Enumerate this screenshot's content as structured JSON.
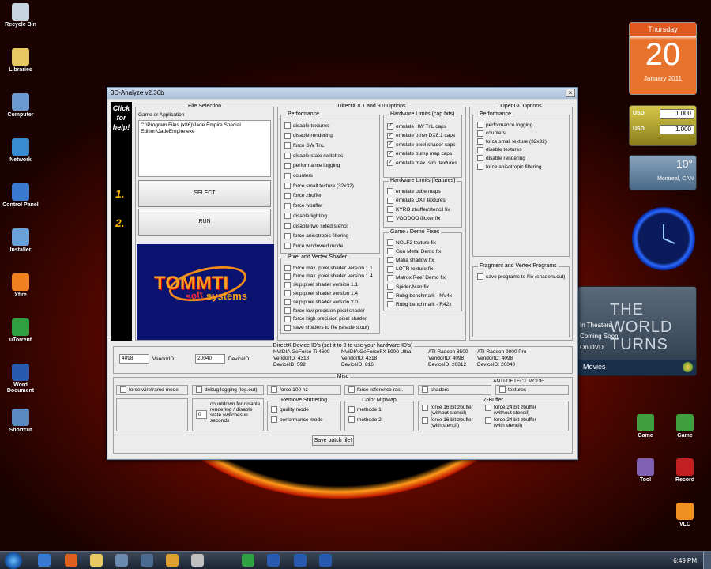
{
  "desktop_icons": [
    {
      "label": "Recycle Bin",
      "color": "#c8d4e0"
    },
    {
      "label": "Libraries",
      "color": "#e8c860"
    },
    {
      "label": "Computer",
      "color": "#6a9ad0"
    },
    {
      "label": "Network",
      "color": "#3a8ad0"
    },
    {
      "label": "Control Panel",
      "color": "#3a7ad0"
    },
    {
      "label": "Installer",
      "color": "#6aa0d8"
    },
    {
      "label": "Xfire",
      "color": "#f08020"
    },
    {
      "label": "uTorrent",
      "color": "#30a040"
    },
    {
      "label": "Word Document",
      "color": "#2a5ab0"
    },
    {
      "label": "Shortcut",
      "color": "#5a8ac0"
    }
  ],
  "right_icons": [
    {
      "label": "Game",
      "color": "#40a040"
    },
    {
      "label": "Game",
      "color": "#40a040"
    },
    {
      "label": "Tool",
      "color": "#8060b0"
    },
    {
      "label": "Record",
      "color": "#c02020"
    },
    {
      "label": "VLC",
      "color": "#f09020"
    }
  ],
  "calendar": {
    "day": "Thursday",
    "date": "20",
    "month": "January 2011"
  },
  "currency": {
    "row1_code": "USD",
    "row1_value": "1.000",
    "row2_code": "USD",
    "row2_value": "1.000"
  },
  "weather": {
    "temp": "10°",
    "city": "Montreal, CAN"
  },
  "movies": {
    "lines": [
      "In Theaters",
      "Coming Soon",
      "On DVD"
    ],
    "footer": "Movies",
    "banner": "THE WORLD TURNS"
  },
  "window": {
    "title": "3D-Analyze v2.36b",
    "close": "×",
    "side_text": "Click for help!",
    "step1": "1.",
    "step2": "2.",
    "file_selection": {
      "title": "File Selection",
      "label": "Game or Application",
      "path": "C:\\Program Files (x86)\\Jade Empire Special Edition\\JadeEmpire.exe",
      "select": "SELECT",
      "run": "RUN"
    },
    "logo": {
      "text1": "TOMMTI",
      "text2": "systems",
      "text3": "soft"
    },
    "dx_title": "DirectX 8.1 and 9.0 Options",
    "performance": {
      "title": "Performance",
      "items": [
        "disable textures",
        "disable rendering",
        "force SW TnL",
        "disable state switches",
        "performance logging",
        "counters",
        "force small texture (32x32)",
        "force zbuffer",
        "force wbuffer",
        "disable lighting",
        "disable two sided stencil",
        "force anisotropic filtering",
        "force windowed mode"
      ]
    },
    "pixel_vertex": {
      "title": "Pixel and Vertex Shader",
      "items": [
        "force max. pixel shader version 1.1",
        "force max. pixel shader version 1.4",
        "skip pixel shader version 1.1",
        "skip pixel shader version 1.4",
        "skip pixel shader version 2.0",
        "force low precision pixel shader",
        "force high precision pixel shader",
        "save shaders to file (shaders.out)"
      ]
    },
    "hw_caps": {
      "title": "Hardware Limits (cap bits)",
      "items": [
        "emulate HW TnL caps",
        "emulate other DX8.1 caps",
        "emulate pixel shader caps",
        "emulate bump map caps",
        "emulate max. sim. textures"
      ],
      "checked": [
        true,
        true,
        true,
        true,
        true
      ]
    },
    "hw_features": {
      "title": "Hardware Limits (features)",
      "items": [
        "emulate cube maps",
        "emulate DXT textures",
        "KYRO zbuffer/stencil fix",
        "VOODOO flicker fix"
      ]
    },
    "game_fixes": {
      "title": "Game / Demo Fixes",
      "items": [
        "NOLF2 texture fix",
        "Gun Metal Demo fix",
        "Mafia shadow fix",
        "LOTR texture fix",
        "Matrox Reef Demo fix",
        "Spider-Man fix",
        "Rubg benchmark - NV4x",
        "Rubg benchmark - R42x"
      ]
    },
    "opengl": {
      "title": "OpenGL Options",
      "perf_title": "Performance",
      "items": [
        "performance logging",
        "counters",
        "force small texture (32x32)",
        "disable textures",
        "disable rendering",
        "force anisotropic filtering"
      ],
      "fv_title": "Fragment and Vertex Programs",
      "fv_items": [
        "save programs to file (shaders.out)"
      ]
    },
    "device": {
      "title": "DirectX Device ID's (set it to 0 to use your hardware ID's)",
      "vendor_value": "4098",
      "vendor_label": "VendorID",
      "device_value": "20040",
      "device_label": "DeviceID",
      "cards": [
        {
          "name": "NVIDIA GeForce Ti 4600",
          "vendor": "VendorID: 4318",
          "device": "DeviceID: 592"
        },
        {
          "name": "NVIDIA GeForceFX 5900 Ultra",
          "vendor": "VendorID: 4318",
          "device": "DeviceID: 816"
        },
        {
          "name": "ATI Radeon 8500",
          "vendor": "VendorID: 4098",
          "device": "DeviceID: 20812"
        },
        {
          "name": "ATI Radeon 9800 Pro",
          "vendor": "VendorID: 4098",
          "device": "DeviceID: 20040"
        }
      ]
    },
    "misc": {
      "title": "Misc",
      "items": [
        "force wireframe mode",
        "debug logging (log.out)",
        "force 100 hz",
        "force reference rast."
      ],
      "countdown_value": "0",
      "countdown_text": "countdown for disable rendering / disable state switches in seconds"
    },
    "anti_detect": {
      "title": "ANTI-DETECT MODE",
      "items": [
        "shaders",
        "textures"
      ]
    },
    "stuttering": {
      "title": "Remove Stuttering",
      "items": [
        "quality mode",
        "performance mode"
      ]
    },
    "mipmap": {
      "title": "Color MipMap",
      "items": [
        "methode 1",
        "methode 2"
      ]
    },
    "zbuffer": {
      "title": "Z-Buffer",
      "items": [
        "force 16 bit zbuffer (without stencil)",
        "force 24 bit zbuffer (without stencil)",
        "force 16 bit zbuffer (with stencil)",
        "force 24 bit zbuffer (with stencil)"
      ]
    },
    "save_batch": "Save batch file!"
  },
  "taskbar": {
    "time": "6:49 PM"
  }
}
